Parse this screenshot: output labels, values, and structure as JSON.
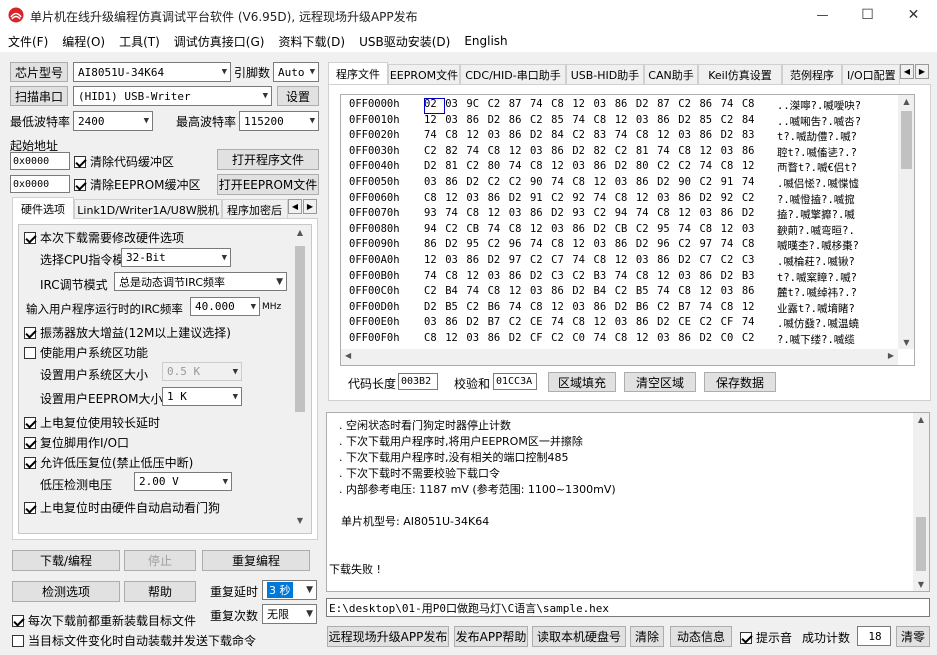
{
  "window": {
    "title": "单片机在线升级编程仿真调试平台软件 (V6.95D), 远程现场升级APP发布",
    "min_label": "—",
    "max_label": "☐",
    "close_label": "✕"
  },
  "menu": [
    "文件(F)",
    "编程(O)",
    "工具(T)",
    "调试仿真接口(G)",
    "资料下载(D)",
    "USB驱动安装(D)",
    "English"
  ],
  "left": {
    "chip_btn": "芯片型号",
    "chip_value": "AI8051U-34K64",
    "pin_label": "引脚数",
    "pin_value": "Auto",
    "scan_btn": "扫描串口",
    "port_value": "(HID1) USB-Writer",
    "settings_btn": "设置",
    "min_baud_label": "最低波特率",
    "min_baud_value": "2400",
    "max_baud_label": "最高波特率",
    "max_baud_value": "115200",
    "start_addr_label": "起始地址",
    "addr1": "0x0000",
    "clear_code_label": "清除代码缓冲区",
    "open_prog_btn": "打开程序文件",
    "addr2": "0x0000",
    "clear_eeprom_label": "清除EEPROM缓冲区",
    "open_eeprom_btn": "打开EEPROM文件",
    "tabs": [
      "硬件选项",
      "Link1D/Writer1A/U8W脱机",
      "程序加密后"
    ],
    "options": {
      "opt1": "本次下载需要修改硬件选项",
      "cpu_label": "选择CPU指令模式",
      "cpu_value": "32-Bit",
      "irc_label": "IRC调节模式",
      "irc_value": "总是动态调节IRC频率",
      "freq_label": "输入用户程序运行时的IRC频率",
      "freq_value": "40.000",
      "freq_unit": "MHz",
      "opt2": "振荡器放大增益(12M以上建议选择)",
      "opt3": "使能用户系统区功能",
      "sys_size_label": "设置用户系统区大小",
      "sys_size_value": "0.5 K",
      "eeprom_size_label": "设置用户EEPROM大小",
      "eeprom_size_value": "1   K",
      "opt4": "上电复位使用较长延时",
      "opt5": "复位脚用作I/O口",
      "opt6": "允许低压复位(禁止低压中断)",
      "lv_label": "低压检测电压",
      "lv_value": "2.00 V",
      "opt7": "上电复位时由硬件自动启动看门狗"
    },
    "download_btn": "下载/编程",
    "stop_btn": "停止",
    "reprogram_btn": "重复编程",
    "check_btn": "检测选项",
    "help_btn": "帮助",
    "repeat_delay_label": "重复延时",
    "repeat_delay_value": "3 秒",
    "reload_label": "每次下载前都重新装载目标文件",
    "repeat_count_label": "重复次数",
    "repeat_count_value": "无限",
    "auto_label": "当目标文件变化时自动装载并发送下载命令"
  },
  "right": {
    "tabs": [
      "程序文件",
      "EEPROM文件",
      "CDC/HID-串口助手",
      "USB-HID助手",
      "CAN助手",
      "Keil仿真设置",
      "范例程序",
      "I/O口配置"
    ],
    "hex_rows": [
      {
        "addr": "0FF0000h",
        "bytes": [
          "02",
          "03",
          "9C",
          "C2",
          "87",
          "74",
          "C8",
          "12",
          "03",
          "86",
          "D2",
          "87",
          "C2",
          "86",
          "74",
          "C8"
        ],
        "ascii": "..滐嚀?.喴噯吷?"
      },
      {
        "addr": "0FF0010h",
        "bytes": [
          "12",
          "03",
          "86",
          "D2",
          "86",
          "C2",
          "85",
          "74",
          "C8",
          "12",
          "03",
          "86",
          "D2",
          "85",
          "C2",
          "84"
        ],
        "ascii": "..喴啝吿?.喴呇?"
      },
      {
        "addr": "0FF0020h",
        "bytes": [
          "74",
          "C8",
          "12",
          "03",
          "86",
          "D2",
          "84",
          "C2",
          "83",
          "74",
          "C8",
          "12",
          "03",
          "86",
          "D2",
          "83"
        ],
        "ascii": "t?.喴劼僼?.喴?"
      },
      {
        "addr": "0FF0030h",
        "bytes": [
          "C2",
          "82",
          "74",
          "C8",
          "12",
          "03",
          "86",
          "D2",
          "82",
          "C2",
          "81",
          "74",
          "C8",
          "12",
          "03",
          "86"
        ],
        "ascii": "聜t?.喴傗乼?.?"
      },
      {
        "addr": "0FF0040h",
        "bytes": [
          "D2",
          "81",
          "C2",
          "80",
          "74",
          "C8",
          "12",
          "03",
          "86",
          "D2",
          "80",
          "C2",
          "C2",
          "74",
          "C8",
          "12"
        ],
        "ascii": "襾瞀t?.喴€侣t?"
      },
      {
        "addr": "0FF0050h",
        "bytes": [
          "03",
          "86",
          "D2",
          "C2",
          "C2",
          "90",
          "74",
          "C8",
          "12",
          "03",
          "86",
          "D2",
          "90",
          "C2",
          "91",
          "74"
        ],
        "ascii": ".喴侣恡?.喴惵憈"
      },
      {
        "addr": "0FF0060h",
        "bytes": [
          "C8",
          "12",
          "03",
          "86",
          "D2",
          "91",
          "C2",
          "92",
          "74",
          "C8",
          "12",
          "03",
          "86",
          "D2",
          "92",
          "C2"
        ],
        "ascii": "?.喴憕搕?.喴搲"
      },
      {
        "addr": "0FF0070h",
        "bytes": [
          "93",
          "74",
          "C8",
          "12",
          "03",
          "86",
          "D2",
          "93",
          "C2",
          "94",
          "74",
          "C8",
          "12",
          "03",
          "86",
          "D2"
        ],
        "ascii": "搕?.喴擎攠?.喴"
      },
      {
        "addr": "0FF0080h",
        "bytes": [
          "94",
          "C2",
          "CB",
          "74",
          "C8",
          "12",
          "03",
          "86",
          "D2",
          "CB",
          "C2",
          "95",
          "74",
          "C8",
          "12",
          "03"
        ],
        "ascii": "斔萴?.喴弯晅?."
      },
      {
        "addr": "0FF0090h",
        "bytes": [
          "86",
          "D2",
          "95",
          "C2",
          "96",
          "74",
          "C8",
          "12",
          "03",
          "86",
          "D2",
          "96",
          "C2",
          "97",
          "74",
          "C8"
        ],
        "ascii": "喴暵杢?.喴栘棗?"
      },
      {
        "addr": "0FF00A0h",
        "bytes": [
          "12",
          "03",
          "86",
          "D2",
          "97",
          "C2",
          "C7",
          "74",
          "C8",
          "12",
          "03",
          "86",
          "D2",
          "C7",
          "C2",
          "C3"
        ],
        "ascii": ".喴棆荰?.喴锹?"
      },
      {
        "addr": "0FF00B0h",
        "bytes": [
          "74",
          "C8",
          "12",
          "03",
          "86",
          "D2",
          "C3",
          "C2",
          "B3",
          "74",
          "C8",
          "12",
          "03",
          "86",
          "D2",
          "B3"
        ],
        "ascii": "t?.喴梥瞕?.喴?"
      },
      {
        "addr": "0FF00C0h",
        "bytes": [
          "C2",
          "B4",
          "74",
          "C8",
          "12",
          "03",
          "86",
          "D2",
          "B4",
          "C2",
          "B5",
          "74",
          "C8",
          "12",
          "03",
          "86"
        ],
        "ascii": "麓t?.喴绰祎?.?"
      },
      {
        "addr": "0FF00D0h",
        "bytes": [
          "D2",
          "B5",
          "C2",
          "B6",
          "74",
          "C8",
          "12",
          "03",
          "86",
          "D2",
          "B6",
          "C2",
          "B7",
          "74",
          "C8",
          "12"
        ],
        "ascii": "业露t?.喴堉睹?"
      },
      {
        "addr": "0FF00E0h",
        "bytes": [
          "03",
          "86",
          "D2",
          "B7",
          "C2",
          "CE",
          "74",
          "C8",
          "12",
          "03",
          "86",
          "D2",
          "CE",
          "C2",
          "CF",
          "74"
        ],
        "ascii": ".喴仿鼗?.喴温蟯"
      },
      {
        "addr": "0FF00F0h",
        "bytes": [
          "C8",
          "12",
          "03",
          "86",
          "D2",
          "CF",
          "C2",
          "C0",
          "74",
          "C8",
          "12",
          "03",
          "86",
          "D2",
          "C0",
          "C2"
        ],
        "ascii": "?.喴下缕?.喴缆"
      }
    ],
    "code_len_label": "代码长度",
    "code_len_value": "003B2",
    "checksum_label": "校验和",
    "checksum_value": "01CC3A",
    "fill_btn": "区域填充",
    "clear_btn": "清空区域",
    "save_btn": "保存数据",
    "log_lines": [
      ". 空闲状态时看门狗定时器停止计数",
      ". 下次下载用户程序时,将用户EEPROM区一并擦除",
      ". 下次下载用户程序时,没有相关的端口控制485",
      ". 下次下载时不需要校验下载口令",
      ". 内部参考电压: 1187 mV (参考范围: 1100~1300mV)",
      "单片机型号: AI8051U-34K64",
      "下载失败 !"
    ],
    "file_path": "E:\\desktop\\01-用P0口做跑马灯\\C语言\\sample.hex",
    "remote_btn": "远程现场升级APP发布",
    "publish_help_btn": "发布APP帮助",
    "read_disk_btn": "读取本机硬盘号",
    "clear_log_btn": "清除",
    "anim_btn": "动态信息",
    "beep_label": "提示音",
    "success_label": "成功计数",
    "success_value": "18",
    "clear_zero_btn": "清零"
  }
}
